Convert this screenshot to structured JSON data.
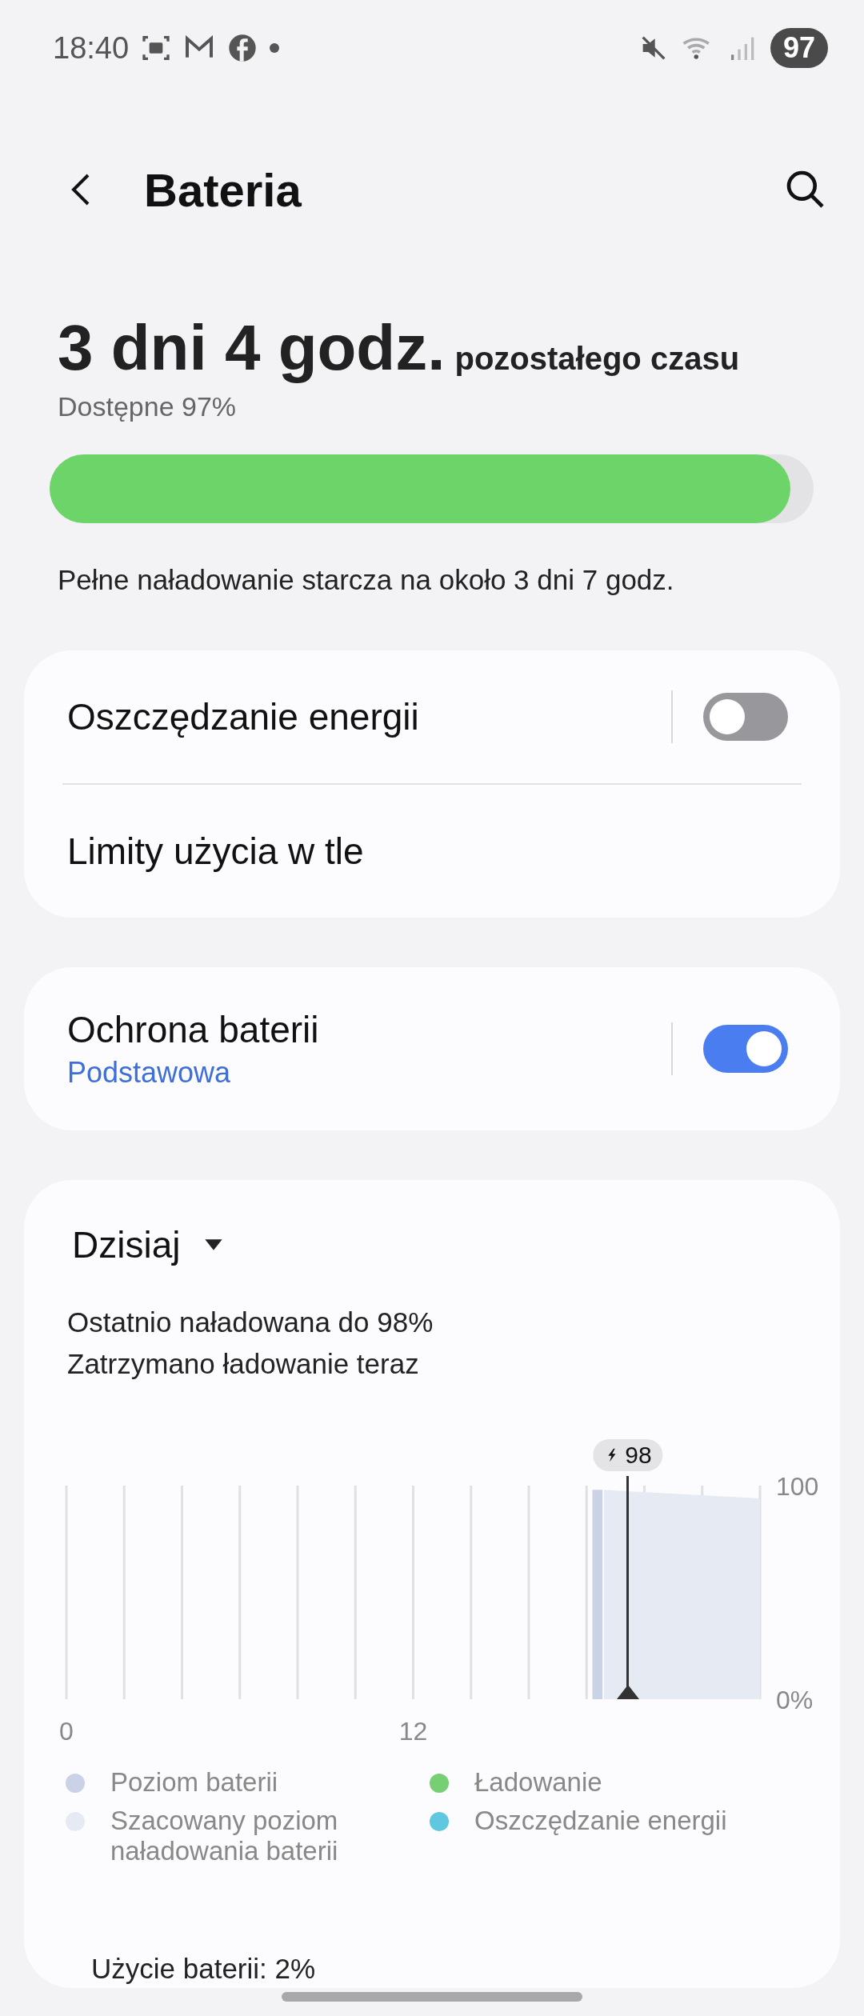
{
  "status_bar": {
    "time": "18:40",
    "battery": "97"
  },
  "header": {
    "title": "Bateria"
  },
  "summary": {
    "remaining": "3 dni 4 godz.",
    "remaining_suffix": "pozostałego czasu",
    "available": "Dostępne 97%",
    "level": 0.97,
    "full_charge": "Pełne naładowanie starcza na około 3 dni 7 godz."
  },
  "settings_card": {
    "items": [
      {
        "kind": "toggle",
        "label": "Oszczędzanie energii",
        "on": false
      },
      {
        "kind": "link",
        "label": "Limity użycia w tle"
      }
    ]
  },
  "protection_card": {
    "label": "Ochrona baterii",
    "subtitle": "Podstawowa",
    "on": true
  },
  "usage_card": {
    "period": "Dzisiaj",
    "lines": [
      "Ostatnio naładowana do 98%",
      "Zatrzymano ładowanie teraz"
    ],
    "marker": {
      "label": "98"
    },
    "chart_data": {
      "type": "area",
      "x": [
        18.2,
        18.55,
        18.6,
        24
      ],
      "xlim": [
        0,
        24
      ],
      "ylim": [
        0,
        100
      ],
      "xticks": [
        0,
        12
      ],
      "yticks": [
        {
          "value": 0,
          "label": "0%"
        },
        {
          "value": 100,
          "label": "100"
        }
      ],
      "series": [
        {
          "color": "#c9d3e5",
          "values": [
            98,
            98,
            null,
            null
          ]
        },
        {
          "color": "#e6ebf3",
          "values": [
            null,
            null,
            98,
            94
          ]
        }
      ]
    },
    "legend": [
      {
        "label": "Poziom baterii",
        "color": "#c9d3e5"
      },
      {
        "label": "Ładowanie",
        "color": "#77cf74"
      },
      {
        "label": "Szacowany poziom naładowania baterii",
        "color": "#e6ebf3"
      },
      {
        "label": "Oszczędzanie energii",
        "color": "#5fc7e0"
      }
    ],
    "footer": "Użycie baterii: 2%"
  }
}
